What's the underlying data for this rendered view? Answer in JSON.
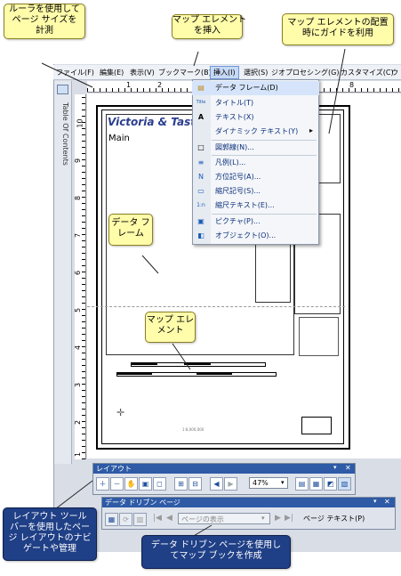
{
  "menubar": {
    "items": [
      "ファイル(F)",
      "編集(E)",
      "表示(V)",
      "ブックマーク(B)",
      "挿入(I)",
      "選択(S)",
      "ジオプロセシング(G)",
      "カスタマイズ(C)",
      "ウ"
    ]
  },
  "toc": {
    "label": "Table Of Contents"
  },
  "ruler": {
    "h_nums": [
      "1",
      "2",
      "8"
    ],
    "v_nums": [
      "10",
      "9",
      "8",
      "7",
      "6",
      "5",
      "4",
      "3",
      "2",
      "1"
    ]
  },
  "map": {
    "title": "Victoria & Tastor",
    "frame_label": "Main",
    "scale_text": "1:8,000,000"
  },
  "insert_menu": {
    "items": [
      {
        "icon": "data-frame-icon",
        "glyph": "▤",
        "label": "データ フレーム(D)"
      },
      {
        "icon": "title-icon",
        "glyph": "Title",
        "label": "タイトル(T)"
      },
      {
        "icon": "text-icon",
        "glyph": "A",
        "label": "テキスト(X)"
      },
      {
        "icon": "dynamic-text-icon",
        "glyph": "",
        "label": "ダイナミック テキスト(Y)",
        "submenu": "▸"
      },
      {
        "icon": "neatline-icon",
        "glyph": "□",
        "label": "図郭線(N)..."
      },
      {
        "icon": "legend-icon",
        "glyph": "≡",
        "label": "凡例(L)..."
      },
      {
        "icon": "north-arrow-icon",
        "glyph": "N",
        "label": "方位記号(A)..."
      },
      {
        "icon": "scale-bar-icon",
        "glyph": "▭",
        "label": "縮尺記号(S)..."
      },
      {
        "icon": "scale-text-icon",
        "glyph": "1:n",
        "label": "縮尺テキスト(E)..."
      },
      {
        "icon": "picture-icon",
        "glyph": "▣",
        "label": "ピクチャ(P)..."
      },
      {
        "icon": "object-icon",
        "glyph": "◧",
        "label": "オブジェクト(O)..."
      }
    ]
  },
  "layout_toolbar": {
    "title": "レイアウト",
    "zoom": "47%",
    "close": "✕",
    "pin": "▾"
  },
  "ddp_toolbar": {
    "title": "データ ドリブン ページ",
    "page_display": "ページの表示",
    "page_text": "ページ テキスト(P)",
    "close": "✕",
    "pin": "▾"
  },
  "callouts": {
    "ruler": "ルーラを使用して\nページ サイズを\n計測",
    "insert": "マップ エレメント\nを挿入",
    "guide": "マップ エレメントの配置\n時にガイドを利用",
    "data_frame": "データ フ\nレーム",
    "map_element": "マップ エレ\nメント",
    "layout_toolbar": "レイアウト ツール\nバーを使用したペー\nジ レイアウトのナビ\nゲートや管理",
    "ddp": "データ ドリブン ページを使用し\nてマップ ブックを作成"
  }
}
